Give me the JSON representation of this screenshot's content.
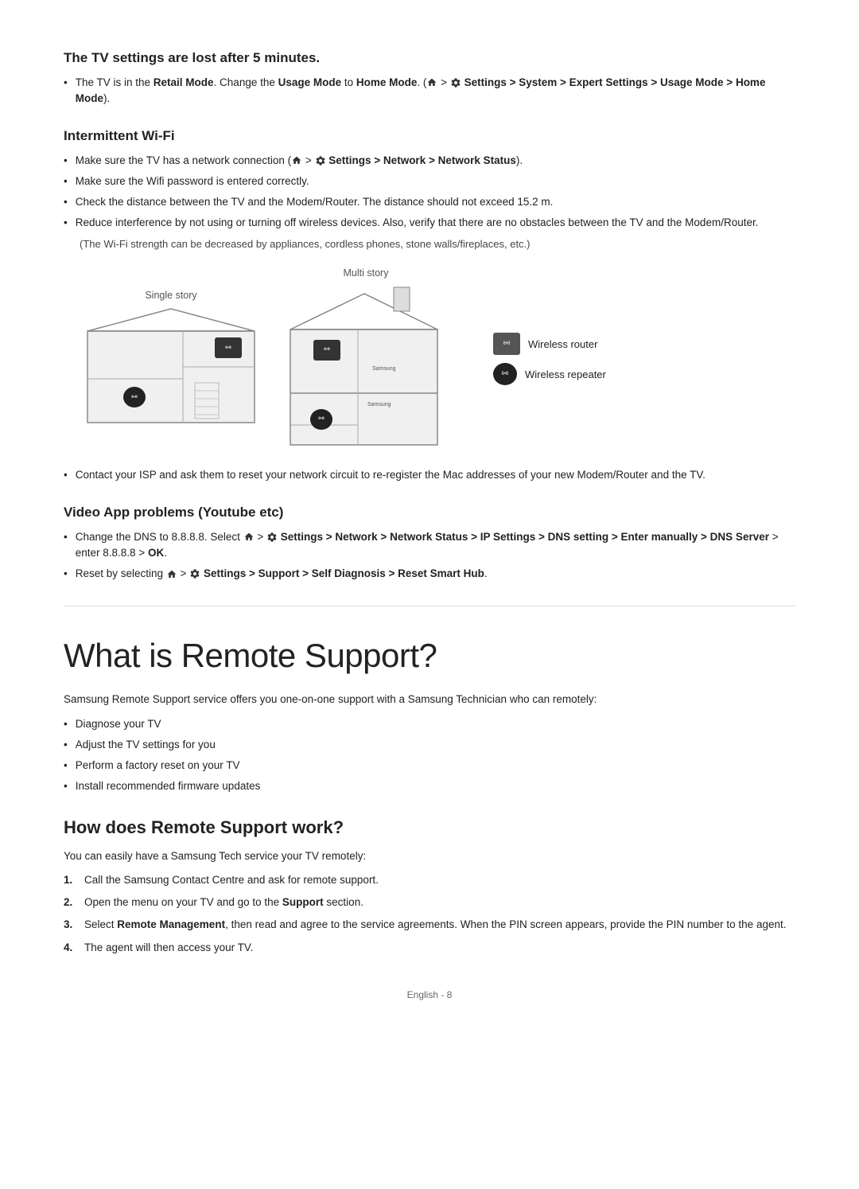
{
  "page": {
    "footer": "English - 8"
  },
  "section1": {
    "title": "The TV settings are lost after 5 minutes.",
    "bullets": [
      {
        "text_parts": [
          {
            "text": "The TV is in the ",
            "style": "normal"
          },
          {
            "text": "Retail Mode",
            "style": "bold"
          },
          {
            "text": ". Change the ",
            "style": "normal"
          },
          {
            "text": "Usage Mode",
            "style": "bold"
          },
          {
            "text": " to ",
            "style": "normal"
          },
          {
            "text": "Home Mode",
            "style": "bold"
          },
          {
            "text": ". (",
            "style": "normal"
          },
          {
            "text": "⌂",
            "style": "icon"
          },
          {
            "text": " > ",
            "style": "normal"
          },
          {
            "text": "⚙",
            "style": "icon"
          },
          {
            "text": " Settings > System > ",
            "style": "bold"
          },
          {
            "text": "Expert Settings",
            "style": "bold"
          },
          {
            "text": " > ",
            "style": "normal"
          },
          {
            "text": "Usage Mode",
            "style": "bold"
          },
          {
            "text": " > ",
            "style": "normal"
          },
          {
            "text": "Home Mode",
            "style": "bold"
          },
          {
            "text": ").",
            "style": "normal"
          }
        ]
      }
    ]
  },
  "section2": {
    "title": "Intermittent Wi-Fi",
    "bullets": [
      "Make sure the TV has a network connection (⌂ > ⚙ Settings > Network > Network Status).",
      "Make sure the Wifi password is entered correctly.",
      "Check the distance between the TV and the Modem/Router. The distance should not exceed 15.2 m.",
      "Reduce interference by not using or turning off wireless devices. Also, verify that there are no obstacles between the TV and the Modem/Router."
    ],
    "note": "(The Wi-Fi strength can be decreased by appliances, cordless phones, stone walls/fireplaces, etc.)",
    "diagram": {
      "single_label": "Single story",
      "multi_label": "Multi story",
      "legend": [
        {
          "label": "Wireless router",
          "type": "router"
        },
        {
          "label": "Wireless repeater",
          "type": "repeater"
        }
      ]
    },
    "after_bullet": "Contact your ISP and ask them to reset your network circuit to re-register the Mac addresses of your new Modem/Router and the TV."
  },
  "section3": {
    "title": "Video App problems (Youtube etc)",
    "bullets": [
      {
        "type": "complex",
        "text": "Change the DNS to 8.8.8.8. Select ⌂ > ⚙ Settings > Network > Network Status > IP Settings > DNS setting > Enter manually > DNS Server > enter 8.8.8.8 > OK."
      },
      {
        "type": "complex",
        "text": "Reset by selecting ⌂ > ⚙ Settings > Support > Self Diagnosis > Reset Smart Hub."
      }
    ]
  },
  "section4": {
    "title": "What is Remote Support?",
    "intro": "Samsung Remote Support service offers you one-on-one support with a Samsung Technician who can remotely:",
    "bullets": [
      "Diagnose your TV",
      "Adjust the TV settings for you",
      "Perform a factory reset on your TV",
      "Install recommended firmware updates"
    ]
  },
  "section5": {
    "title": "How does Remote Support work?",
    "intro": "You can easily have a Samsung Tech service your TV remotely:",
    "steps": [
      "Call the Samsung Contact Centre and ask for remote support.",
      "Open the menu on your TV and go to the Support section.",
      "Select Remote Management, then read and agree to the service agreements. When the PIN screen appears, provide the PIN number to the agent.",
      "The agent will then access your TV."
    ]
  }
}
